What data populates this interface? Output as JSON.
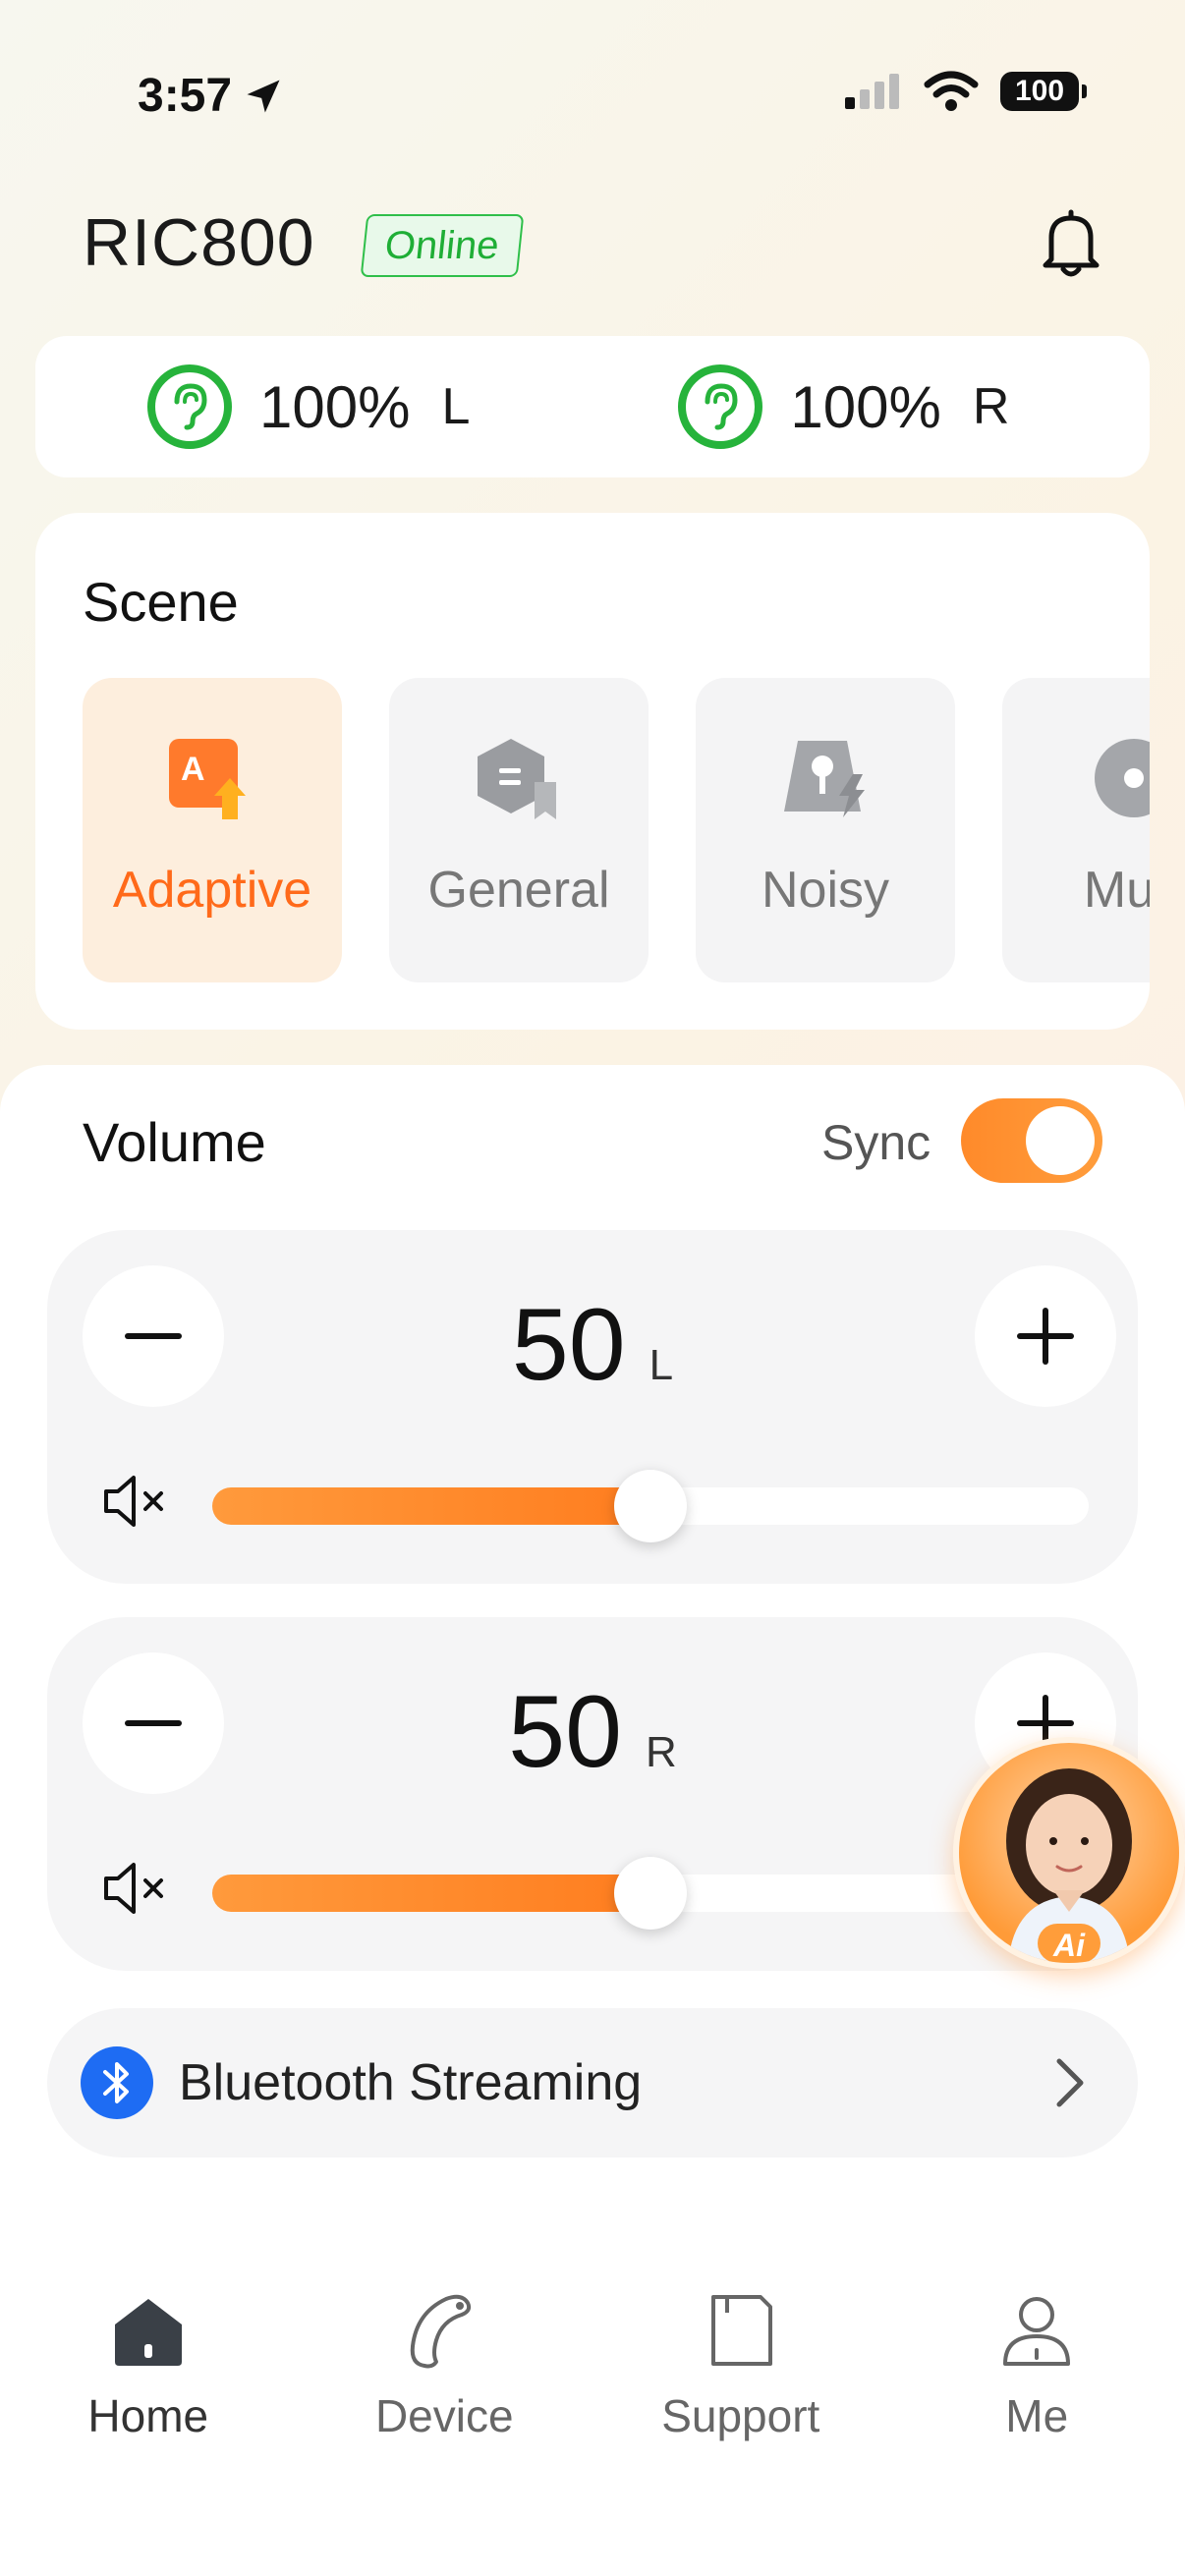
{
  "status_bar": {
    "time": "3:57",
    "battery": "100"
  },
  "header": {
    "device_name": "RIC800",
    "status": "Online"
  },
  "batteries": [
    {
      "level": "100%",
      "side": "L"
    },
    {
      "level": "100%",
      "side": "R"
    }
  ],
  "scene": {
    "title": "Scene",
    "items": [
      {
        "label": "Adaptive",
        "active": true
      },
      {
        "label": "General",
        "active": false
      },
      {
        "label": "Noisy",
        "active": false
      },
      {
        "label": "Mus",
        "active": false
      }
    ]
  },
  "volume": {
    "title": "Volume",
    "sync_label": "Sync",
    "sync_on": true,
    "left": {
      "value": "50",
      "side": "L",
      "slider": 0.5
    },
    "right": {
      "value": "50",
      "side": "R",
      "slider": 0.5
    }
  },
  "assistant": {
    "badge": "Ai"
  },
  "bluetooth": {
    "label": "Bluetooth Streaming"
  },
  "tabs": [
    {
      "label": "Home",
      "icon": "home-icon",
      "active": true
    },
    {
      "label": "Device",
      "icon": "hearing-aid-icon",
      "active": false
    },
    {
      "label": "Support",
      "icon": "support-icon",
      "active": false
    },
    {
      "label": "Me",
      "icon": "person-icon",
      "active": false
    }
  ],
  "colors": {
    "accent": "#FF7D1F",
    "online": "#26B33B",
    "bluetooth": "#1E6CF3"
  }
}
